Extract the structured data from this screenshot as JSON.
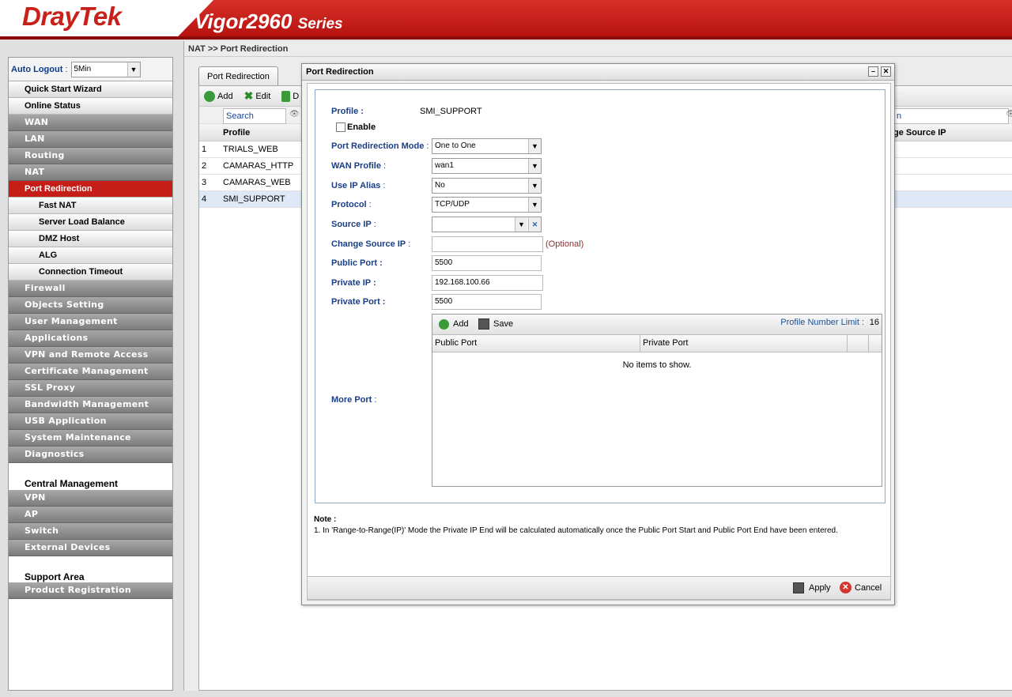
{
  "header": {
    "brand": "DrayTek",
    "model": "Vigor2960",
    "series": "Series"
  },
  "sidebar": {
    "auto_logout_label": "Auto Logout",
    "auto_logout_value": "5Min",
    "items": [
      {
        "label": "Quick Start Wizard",
        "style": "light"
      },
      {
        "label": "Online Status",
        "style": "light"
      },
      {
        "label": "WAN",
        "style": "grey"
      },
      {
        "label": "LAN",
        "style": "grey"
      },
      {
        "label": "Routing",
        "style": "grey"
      },
      {
        "label": "NAT",
        "style": "grey"
      },
      {
        "label": "Port Redirection",
        "style": "active"
      },
      {
        "label": "Fast NAT",
        "style": "sub"
      },
      {
        "label": "Server Load Balance",
        "style": "sub"
      },
      {
        "label": "DMZ Host",
        "style": "sub"
      },
      {
        "label": "ALG",
        "style": "sub"
      },
      {
        "label": "Connection Timeout",
        "style": "sub"
      },
      {
        "label": "Firewall",
        "style": "grey"
      },
      {
        "label": "Objects Setting",
        "style": "grey"
      },
      {
        "label": "User Management",
        "style": "grey"
      },
      {
        "label": "Applications",
        "style": "grey"
      },
      {
        "label": "VPN and Remote Access",
        "style": "grey"
      },
      {
        "label": "Certificate Management",
        "style": "grey"
      },
      {
        "label": "SSL Proxy",
        "style": "grey"
      },
      {
        "label": "Bandwidth Management",
        "style": "grey"
      },
      {
        "label": "USB Application",
        "style": "grey"
      },
      {
        "label": "System Maintenance",
        "style": "grey"
      },
      {
        "label": "Diagnostics",
        "style": "grey"
      }
    ],
    "central_title": "Central Management",
    "central_items": [
      "VPN",
      "AP",
      "Switch",
      "External Devices"
    ],
    "support_title": "Support Area",
    "support_items": [
      "Product Registration"
    ]
  },
  "breadcrumb": "NAT >> Port Redirection",
  "tab_label": "Port Redirection",
  "toolbar": {
    "add": "Add",
    "edit": "Edit",
    "delete": "D"
  },
  "search_placeholder": "Search",
  "search_right": "n",
  "columns": {
    "profile": "Profile",
    "change_source_ip": "ge Source IP"
  },
  "rows": [
    {
      "n": "1",
      "profile": "TRIALS_WEB"
    },
    {
      "n": "2",
      "profile": "CAMARAS_HTTP"
    },
    {
      "n": "3",
      "profile": "CAMARAS_WEB"
    },
    {
      "n": "4",
      "profile": "SMI_SUPPORT"
    }
  ],
  "dialog": {
    "title": "Port Redirection",
    "profile_label": "Profile :",
    "profile_value": "SMI_SUPPORT",
    "enable_label": "Enable",
    "mode_label": "Port Redirection Mode",
    "mode_value": "One to One",
    "wan_label": "WAN Profile",
    "wan_value": "wan1",
    "alias_label": "Use IP Alias",
    "alias_value": "No",
    "protocol_label": "Protocol",
    "protocol_value": "TCP/UDP",
    "source_ip_label": "Source IP",
    "change_source_label": "Change Source IP",
    "optional": "(Optional)",
    "public_port_label": "Public Port :",
    "public_port_value": "5500",
    "private_ip_label": "Private IP :",
    "private_ip_value": "192.168.100.66",
    "private_port_label": "Private Port :",
    "private_port_value": "5500",
    "more_port_label": "More Port",
    "grid_add": "Add",
    "grid_save": "Save",
    "limit_label": "Profile Number Limit :",
    "limit_value": "16",
    "col_public": "Public Port",
    "col_private": "Private Port",
    "no_items": "No items to show.",
    "note_title": "Note :",
    "note_text": "1. In 'Range-to-Range(IP)' Mode the Private IP End will be calculated automatically once the Public Port Start and Public Port End have been entered.",
    "apply": "Apply",
    "cancel": "Cancel"
  },
  "colors": {
    "brand_red": "#c51d17",
    "label_blue": "#1a3e85"
  }
}
